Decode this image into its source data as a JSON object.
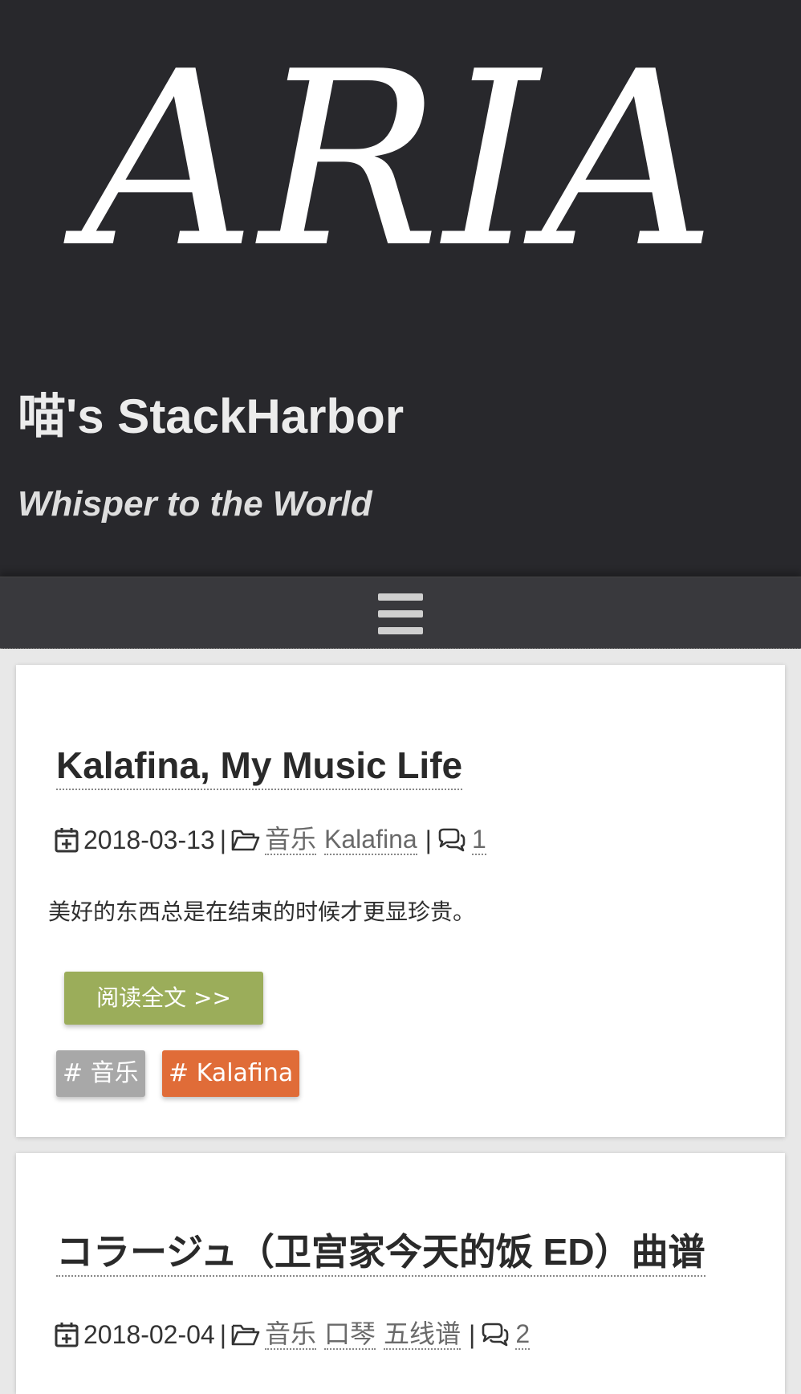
{
  "header": {
    "logo_text": "ARIA",
    "site_title": "喵's StackHarbor",
    "site_subtitle": "Whisper to the World"
  },
  "navbar": {
    "menu_icon": "hamburger-menu-icon"
  },
  "posts": [
    {
      "title": "Kalafina, My Music Life",
      "date": "2018-03-13",
      "categories": [
        "音乐",
        "Kalafina"
      ],
      "comment_count": "1",
      "excerpt": "美好的东西总是在结束的时候才更显珍贵。",
      "read_more_label": "阅读全文 >>",
      "tags": [
        "# 音乐",
        "# Kalafina"
      ]
    },
    {
      "title": "コラージュ（卫宫家今天的饭 ED）曲谱",
      "date": "2018-02-04",
      "categories": [
        "音乐",
        "口琴",
        "五线谱"
      ],
      "comment_count": "2"
    }
  ],
  "meta_separator": "|",
  "colors": {
    "header_bg": "#28282c",
    "navbar_bg": "#39393d",
    "read_more_bg": "#9bad5a",
    "tag_gray": "#a8a8a8",
    "tag_orange": "#e06c38"
  }
}
